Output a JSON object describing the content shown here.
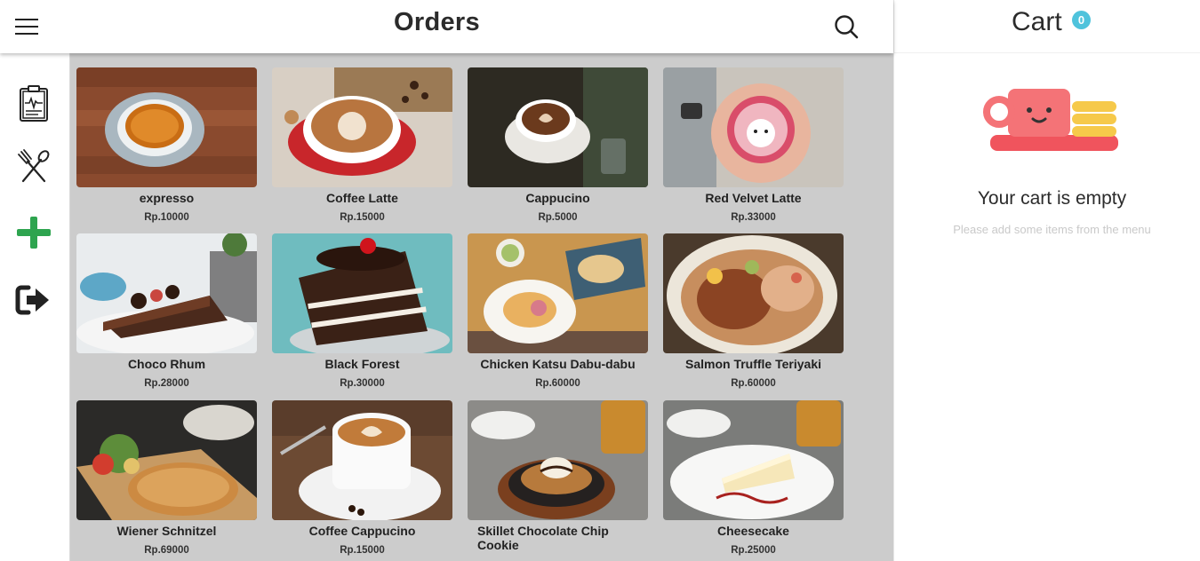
{
  "header": {
    "title": "Orders"
  },
  "cart": {
    "title": "Cart",
    "count": "0",
    "empty_title": "Your cart is empty",
    "empty_subtitle": "Please add some items from the menu"
  },
  "sidebar": {
    "items": [
      {
        "icon": "clipboard-chart-icon"
      },
      {
        "icon": "fork-spoon-icon"
      },
      {
        "icon": "plus-icon",
        "color": "#2ea44f"
      },
      {
        "icon": "sign-out-icon"
      }
    ]
  },
  "menu": {
    "items": [
      {
        "name": "expresso",
        "price": "Rp.10000"
      },
      {
        "name": "Coffee Latte",
        "price": "Rp.15000"
      },
      {
        "name": "Cappucino",
        "price": "Rp.5000"
      },
      {
        "name": "Red Velvet Latte",
        "price": "Rp.33000"
      },
      {
        "name": "Choco Rhum",
        "price": "Rp.28000"
      },
      {
        "name": "Black Forest",
        "price": "Rp.30000"
      },
      {
        "name": "Chicken Katsu Dabu-dabu",
        "price": "Rp.60000"
      },
      {
        "name": "Salmon Truffle Teriyaki",
        "price": "Rp.60000"
      },
      {
        "name": "Wiener Schnitzel",
        "price": "Rp.69000"
      },
      {
        "name": "Coffee Cappucino",
        "price": "Rp.15000"
      },
      {
        "name": "Skillet Chocolate Chip Cookie",
        "price": ""
      },
      {
        "name": "Cheesecake",
        "price": "Rp.25000"
      }
    ]
  },
  "colors": {
    "accent": "#4fc3dc",
    "add_green": "#2ea44f",
    "grid_bg": "#cccccc",
    "cup_red": "#f0545d",
    "cookie_yellow": "#f6c94a"
  }
}
